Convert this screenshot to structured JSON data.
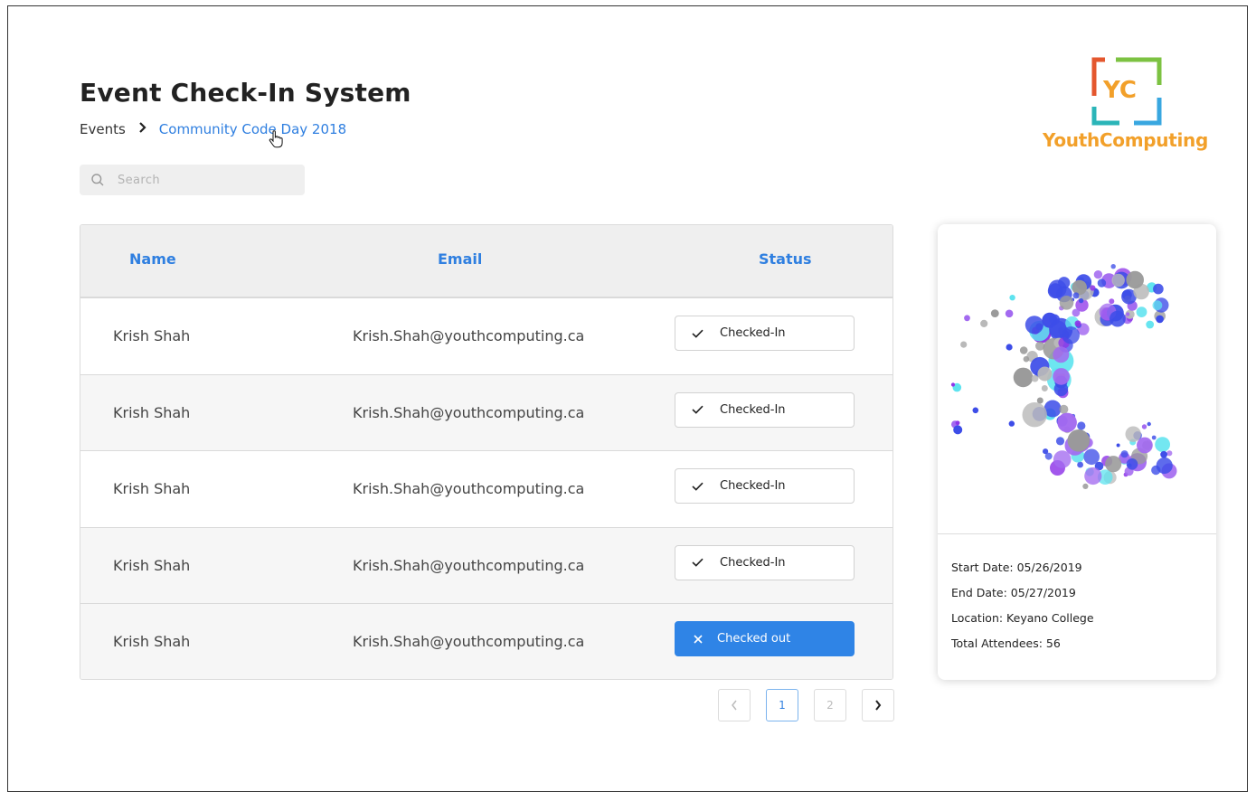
{
  "header": {
    "title": "Event Check-In System",
    "breadcrumb": {
      "root": "Events",
      "current": "Community Code Day 2018"
    }
  },
  "search": {
    "placeholder": "Search",
    "value": ""
  },
  "logo": {
    "monogram": "YC",
    "text": "YouthComputing"
  },
  "table": {
    "columns": [
      "Name",
      "Email",
      "Status"
    ],
    "rows": [
      {
        "name": "Krish Shah",
        "email": "Krish.Shah@youthcomputing.ca",
        "status": "Checked-In"
      },
      {
        "name": "Krish Shah",
        "email": "Krish.Shah@youthcomputing.ca",
        "status": "Checked-In"
      },
      {
        "name": "Krish Shah",
        "email": "Krish.Shah@youthcomputing.ca",
        "status": "Checked-In"
      },
      {
        "name": "Krish Shah",
        "email": "Krish.Shah@youthcomputing.ca",
        "status": "Checked-In"
      },
      {
        "name": "Krish Shah",
        "email": "Krish.Shah@youthcomputing.ca",
        "status": "Checked out"
      }
    ]
  },
  "pagination": {
    "pages": [
      "1",
      "2"
    ],
    "current": "1"
  },
  "event_card": {
    "start_date": "Start Date: 05/26/2019",
    "end_date": "End Date: 05/27/2019",
    "location": "Location: Keyano College",
    "attendees": "Total Attendees: 56"
  },
  "colors": {
    "accent": "#2f7fe0",
    "checked_out_bg": "#2f84e6",
    "logo_orange": "#f2a02a",
    "logo_green": "#7cc242",
    "logo_teal": "#2bb5b8",
    "logo_red": "#e4572e",
    "logo_blue": "#39a7e0"
  },
  "icons": [
    "search-icon",
    "chevron-right-icon",
    "check-icon",
    "close-icon",
    "chevron-left-icon",
    "pointer-cursor-icon"
  ]
}
